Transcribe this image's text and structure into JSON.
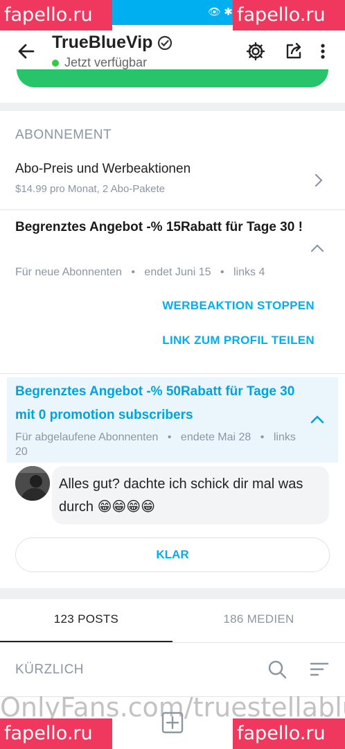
{
  "watermarks": {
    "tl": "fapello.ru",
    "tr": "fapello.ru",
    "bl": "fapello.ru",
    "br": "fapello.ru"
  },
  "header": {
    "title": "TrueBlueVip",
    "status": "Jetzt verfügbar"
  },
  "subscription": {
    "heading": "ABONNEMENT",
    "price_row": {
      "title": "Abo-Preis und Werbeaktionen",
      "subtitle": "$14.99 pro Monat, 2 Abo-Pakete"
    },
    "offer1": {
      "title": "Begrenztes Angebot -% 15Rabatt für Tage 30 !",
      "meta_audience": "Für neue Abonnenten",
      "meta_ends": "endet Juni 15",
      "meta_left": "links 4",
      "action_stop": "WERBEAKTION STOPPEN",
      "action_share": "LINK ZUM PROFIL TEILEN"
    },
    "offer2": {
      "title": "Begrenztes Angebot -% 50Rabatt für Tage 30 mit 0 promotion subscribers",
      "meta_audience": "Für abgelaufene Abonnenten",
      "meta_ends": "endete Mai 28",
      "meta_left": "links 20"
    }
  },
  "message": {
    "text": "Alles gut? dachte ich schick dir mal was durch 😁😁😁😁",
    "button": "KLAR"
  },
  "tabs": [
    {
      "label": "123 POSTS"
    },
    {
      "label": "186 MEDIEN"
    }
  ],
  "recent": {
    "label": "KÜRZLICH"
  },
  "footer_watermark": "OnlyFans.com/truestellablu",
  "colors": {
    "accent": "#00aff0",
    "green": "#27c46a",
    "watermark": "#f0385e"
  }
}
